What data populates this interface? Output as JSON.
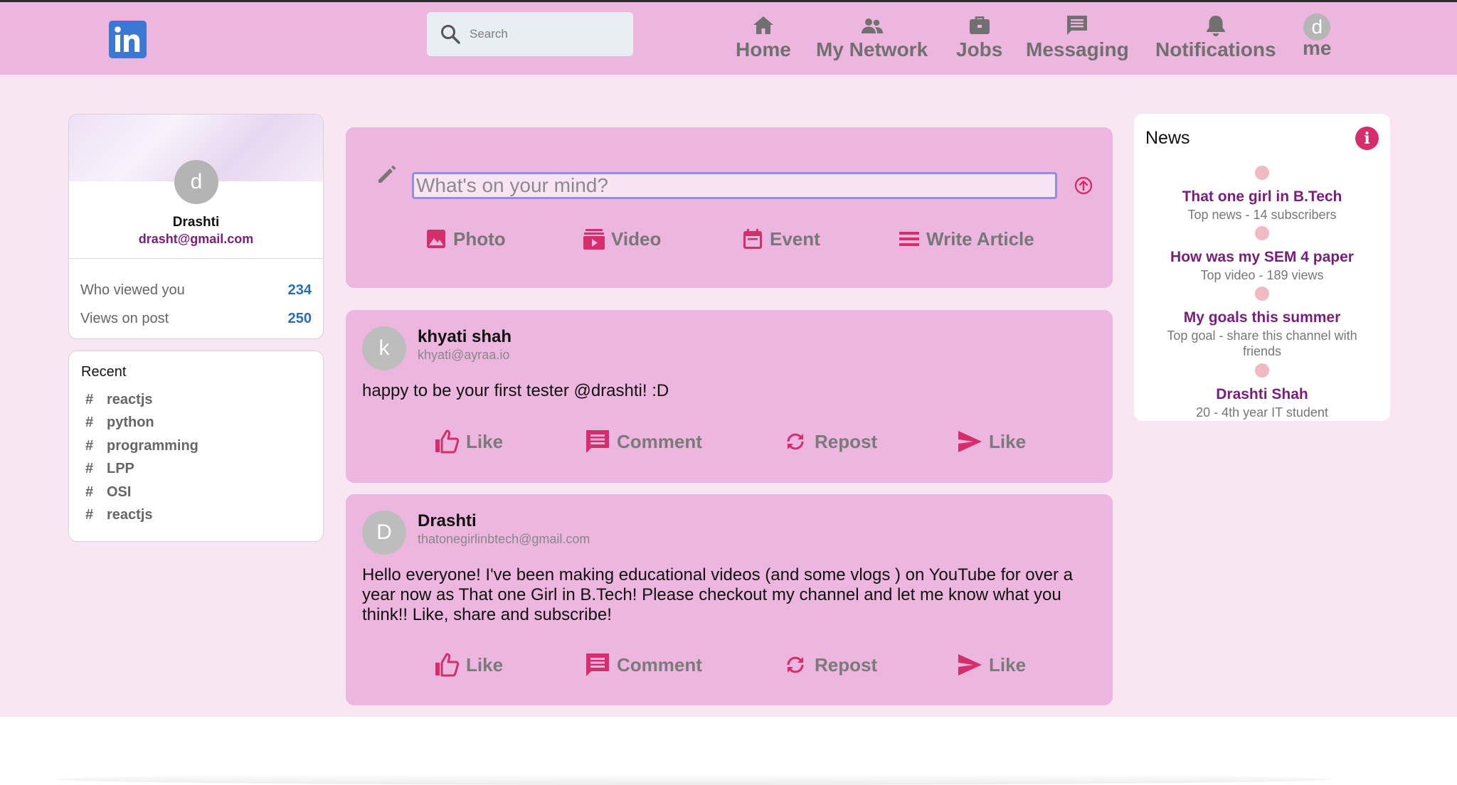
{
  "header": {
    "search_placeholder": "Search",
    "nav": [
      {
        "label": "Home",
        "icon": "home-icon"
      },
      {
        "label": "My Network",
        "icon": "network-icon"
      },
      {
        "label": "Jobs",
        "icon": "briefcase-icon"
      },
      {
        "label": "Messaging",
        "icon": "message-icon"
      },
      {
        "label": "Notifications",
        "icon": "bell-icon"
      },
      {
        "label": "me",
        "avatar_letter": "d"
      }
    ]
  },
  "profile": {
    "avatar_letter": "d",
    "name": "Drashti",
    "email": "drasht@gmail.com",
    "stats": [
      {
        "label": "Who viewed you",
        "value": "234"
      },
      {
        "label": "Views on post",
        "value": "250"
      }
    ]
  },
  "recent": {
    "title": "Recent",
    "hash": "#",
    "tags": [
      "reactjs",
      "python",
      "programming",
      "LPP",
      "OSI",
      "reactjs"
    ]
  },
  "composer": {
    "placeholder": "What's on your mind?",
    "actions": [
      {
        "label": "Photo",
        "icon": "photo-icon"
      },
      {
        "label": "Video",
        "icon": "video-icon"
      },
      {
        "label": "Event",
        "icon": "calendar-icon"
      },
      {
        "label": "Write Article",
        "icon": "article-icon"
      }
    ]
  },
  "posts": [
    {
      "avatar_letter": "k",
      "author": "khyati shah",
      "email": "khyati@ayraa.io",
      "text": "happy to be your first tester @drashti! :D",
      "actions": [
        "Like",
        "Comment",
        "Repost",
        "Like"
      ]
    },
    {
      "avatar_letter": "D",
      "author": "Drashti",
      "email": "thatonegirlinbtech@gmail.com",
      "text": "Hello everyone! I've been making educational videos (and some vlogs ) on YouTube for over a year now as That one Girl in B.Tech! Please checkout my channel and let me know what you think!! Like, share and subscribe!",
      "actions": [
        "Like",
        "Comment",
        "Repost",
        "Like"
      ]
    }
  ],
  "news": {
    "title": "News",
    "info_glyph": "i",
    "items": [
      {
        "heading": "That one girl in B.Tech",
        "sub": "Top news - 14 subscribers"
      },
      {
        "heading": "How was my SEM 4 paper",
        "sub": "Top video - 189 views"
      },
      {
        "heading": "My goals this summer",
        "sub": "Top goal - share this channel with friends"
      },
      {
        "heading": "Drashti Shah",
        "sub": "20 - 4th year IT student"
      }
    ]
  },
  "colors": {
    "header_bg": "#ecb6de",
    "page_bg": "#f9e6f3",
    "accent": "#d62e6d",
    "news_heading": "#7a1e7e",
    "stat_value": "#2b6cb8",
    "linkedin_blue": "#3b78d4"
  }
}
